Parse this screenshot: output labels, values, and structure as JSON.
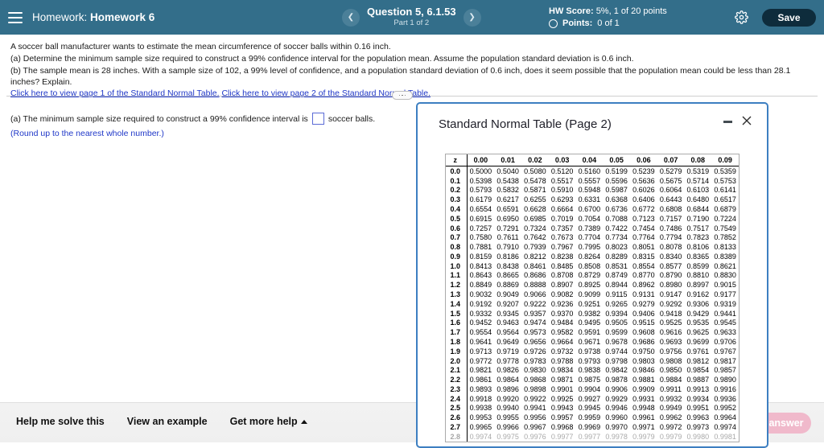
{
  "header": {
    "menu_icon": "hamburger-icon",
    "label_prefix": "Homework:",
    "assignment": "Homework 6",
    "prev_icon": "chevron-left-icon",
    "next_icon": "chevron-right-icon",
    "question_title": "Question 5, 6.1.53",
    "question_part": "Part 1 of 2",
    "hw_score_label": "HW Score:",
    "hw_score_value": "5%, 1 of 20 points",
    "points_label": "Points:",
    "points_value": "0 of 1",
    "settings_icon": "gear-icon",
    "save_label": "Save",
    "bar_color": "#336e8a",
    "save_color": "#0e2c3c"
  },
  "question": {
    "stem": "A soccer ball manufacturer wants to estimate the mean circumference of soccer balls within 0.16 inch.",
    "part_a": "(a) Determine the minimum sample size required to construct a 99% confidence interval for the population mean. Assume the population standard deviation is 0.6 inch.",
    "part_b": "(b) The sample mean is 28 inches. With a sample size of 102, a 99% level of confidence, and a population standard deviation of 0.6 inch, does it seem possible that the population mean could be less than 28.1 inches? Explain.",
    "link1": "Click here to view page 1 of the Standard Normal Table.",
    "link2": "Click here to view page 2 of the Standard Normal Table.",
    "link_color": "#2038c8"
  },
  "answer": {
    "prompt_before": "(a) The minimum sample size required to construct a 99% confidence interval is",
    "prompt_after": "soccer balls.",
    "input_value": "",
    "hint": "(Round up to the nearest whole number.)"
  },
  "toolbar": {
    "help_me_solve": "Help me solve this",
    "view_example": "View an example",
    "get_more_help": "Get more help",
    "caret_icon": "caret-up-icon",
    "check_answer": "Check answer",
    "check_answer_color": "#f0b9cb"
  },
  "popup": {
    "title": "Standard Normal Table (Page 2)",
    "minimize_icon": "minimize-icon",
    "close_icon": "close-icon",
    "border_color": "#3d7fc1"
  },
  "chart_data": {
    "type": "table",
    "title": "Standard Normal Table (Page 2)",
    "xlabel": "",
    "ylabel": "",
    "columns": [
      "z",
      "0.00",
      "0.01",
      "0.02",
      "0.03",
      "0.04",
      "0.05",
      "0.06",
      "0.07",
      "0.08",
      "0.09"
    ],
    "rows": [
      [
        "0.0",
        "0.5000",
        "0.5040",
        "0.5080",
        "0.5120",
        "0.5160",
        "0.5199",
        "0.5239",
        "0.5279",
        "0.5319",
        "0.5359"
      ],
      [
        "0.1",
        "0.5398",
        "0.5438",
        "0.5478",
        "0.5517",
        "0.5557",
        "0.5596",
        "0.5636",
        "0.5675",
        "0.5714",
        "0.5753"
      ],
      [
        "0.2",
        "0.5793",
        "0.5832",
        "0.5871",
        "0.5910",
        "0.5948",
        "0.5987",
        "0.6026",
        "0.6064",
        "0.6103",
        "0.6141"
      ],
      [
        "0.3",
        "0.6179",
        "0.6217",
        "0.6255",
        "0.6293",
        "0.6331",
        "0.6368",
        "0.6406",
        "0.6443",
        "0.6480",
        "0.6517"
      ],
      [
        "0.4",
        "0.6554",
        "0.6591",
        "0.6628",
        "0.6664",
        "0.6700",
        "0.6736",
        "0.6772",
        "0.6808",
        "0.6844",
        "0.6879"
      ],
      [
        "0.5",
        "0.6915",
        "0.6950",
        "0.6985",
        "0.7019",
        "0.7054",
        "0.7088",
        "0.7123",
        "0.7157",
        "0.7190",
        "0.7224"
      ],
      [
        "0.6",
        "0.7257",
        "0.7291",
        "0.7324",
        "0.7357",
        "0.7389",
        "0.7422",
        "0.7454",
        "0.7486",
        "0.7517",
        "0.7549"
      ],
      [
        "0.7",
        "0.7580",
        "0.7611",
        "0.7642",
        "0.7673",
        "0.7704",
        "0.7734",
        "0.7764",
        "0.7794",
        "0.7823",
        "0.7852"
      ],
      [
        "0.8",
        "0.7881",
        "0.7910",
        "0.7939",
        "0.7967",
        "0.7995",
        "0.8023",
        "0.8051",
        "0.8078",
        "0.8106",
        "0.8133"
      ],
      [
        "0.9",
        "0.8159",
        "0.8186",
        "0.8212",
        "0.8238",
        "0.8264",
        "0.8289",
        "0.8315",
        "0.8340",
        "0.8365",
        "0.8389"
      ],
      [
        "1.0",
        "0.8413",
        "0.8438",
        "0.8461",
        "0.8485",
        "0.8508",
        "0.8531",
        "0.8554",
        "0.8577",
        "0.8599",
        "0.8621"
      ],
      [
        "1.1",
        "0.8643",
        "0.8665",
        "0.8686",
        "0.8708",
        "0.8729",
        "0.8749",
        "0.8770",
        "0.8790",
        "0.8810",
        "0.8830"
      ],
      [
        "1.2",
        "0.8849",
        "0.8869",
        "0.8888",
        "0.8907",
        "0.8925",
        "0.8944",
        "0.8962",
        "0.8980",
        "0.8997",
        "0.9015"
      ],
      [
        "1.3",
        "0.9032",
        "0.9049",
        "0.9066",
        "0.9082",
        "0.9099",
        "0.9115",
        "0.9131",
        "0.9147",
        "0.9162",
        "0.9177"
      ],
      [
        "1.4",
        "0.9192",
        "0.9207",
        "0.9222",
        "0.9236",
        "0.9251",
        "0.9265",
        "0.9279",
        "0.9292",
        "0.9306",
        "0.9319"
      ],
      [
        "1.5",
        "0.9332",
        "0.9345",
        "0.9357",
        "0.9370",
        "0.9382",
        "0.9394",
        "0.9406",
        "0.9418",
        "0.9429",
        "0.9441"
      ],
      [
        "1.6",
        "0.9452",
        "0.9463",
        "0.9474",
        "0.9484",
        "0.9495",
        "0.9505",
        "0.9515",
        "0.9525",
        "0.9535",
        "0.9545"
      ],
      [
        "1.7",
        "0.9554",
        "0.9564",
        "0.9573",
        "0.9582",
        "0.9591",
        "0.9599",
        "0.9608",
        "0.9616",
        "0.9625",
        "0.9633"
      ],
      [
        "1.8",
        "0.9641",
        "0.9649",
        "0.9656",
        "0.9664",
        "0.9671",
        "0.9678",
        "0.9686",
        "0.9693",
        "0.9699",
        "0.9706"
      ],
      [
        "1.9",
        "0.9713",
        "0.9719",
        "0.9726",
        "0.9732",
        "0.9738",
        "0.9744",
        "0.9750",
        "0.9756",
        "0.9761",
        "0.9767"
      ],
      [
        "2.0",
        "0.9772",
        "0.9778",
        "0.9783",
        "0.9788",
        "0.9793",
        "0.9798",
        "0.9803",
        "0.9808",
        "0.9812",
        "0.9817"
      ],
      [
        "2.1",
        "0.9821",
        "0.9826",
        "0.9830",
        "0.9834",
        "0.9838",
        "0.9842",
        "0.9846",
        "0.9850",
        "0.9854",
        "0.9857"
      ],
      [
        "2.2",
        "0.9861",
        "0.9864",
        "0.9868",
        "0.9871",
        "0.9875",
        "0.9878",
        "0.9881",
        "0.9884",
        "0.9887",
        "0.9890"
      ],
      [
        "2.3",
        "0.9893",
        "0.9896",
        "0.9898",
        "0.9901",
        "0.9904",
        "0.9906",
        "0.9909",
        "0.9911",
        "0.9913",
        "0.9916"
      ],
      [
        "2.4",
        "0.9918",
        "0.9920",
        "0.9922",
        "0.9925",
        "0.9927",
        "0.9929",
        "0.9931",
        "0.9932",
        "0.9934",
        "0.9936"
      ],
      [
        "2.5",
        "0.9938",
        "0.9940",
        "0.9941",
        "0.9943",
        "0.9945",
        "0.9946",
        "0.9948",
        "0.9949",
        "0.9951",
        "0.9952"
      ],
      [
        "2.6",
        "0.9953",
        "0.9955",
        "0.9956",
        "0.9957",
        "0.9959",
        "0.9960",
        "0.9961",
        "0.9962",
        "0.9963",
        "0.9964"
      ],
      [
        "2.7",
        "0.9965",
        "0.9966",
        "0.9967",
        "0.9968",
        "0.9969",
        "0.9970",
        "0.9971",
        "0.9972",
        "0.9973",
        "0.9974"
      ],
      [
        "2.8",
        "0.9974",
        "0.9975",
        "0.9976",
        "0.9977",
        "0.9977",
        "0.9978",
        "0.9979",
        "0.9979",
        "0.9980",
        "0.9981"
      ]
    ]
  }
}
